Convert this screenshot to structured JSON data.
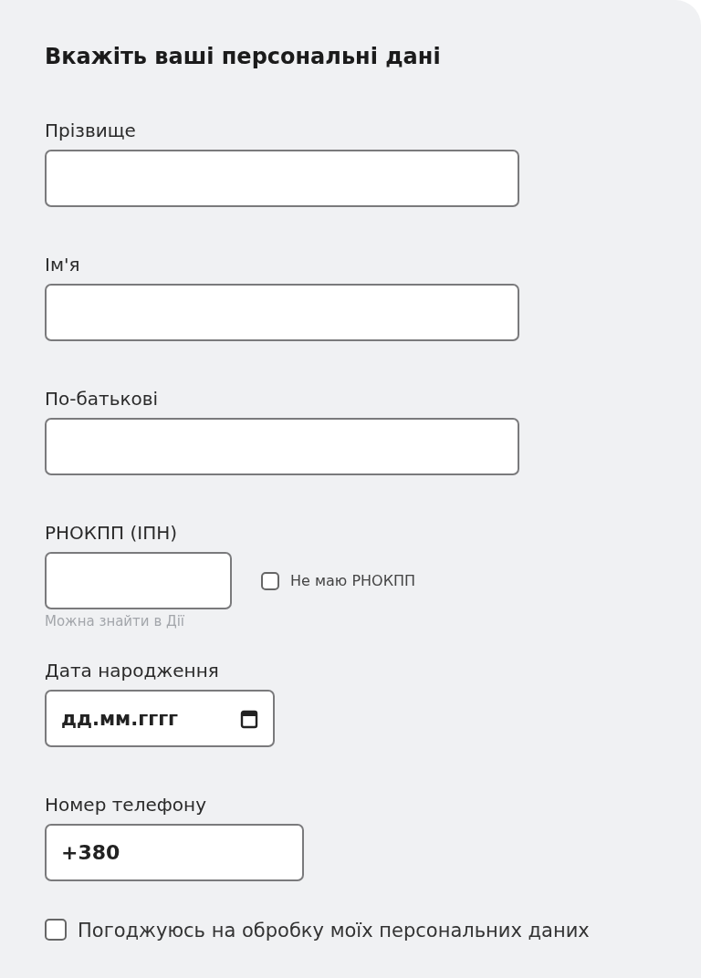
{
  "form": {
    "title": "Вкажіть ваші персональні дані",
    "fields": [
      {
        "kind": "text",
        "label": "Прізвище"
      },
      {
        "kind": "text",
        "label": "Ім'я"
      },
      {
        "kind": "text",
        "label": "По-батькові"
      },
      {
        "kind": "tax",
        "label": "РНОКПП (ІПН)",
        "hint": "Можна знайти в Дії",
        "option": {
          "label": "Не маю РНОКПП",
          "checked": false
        }
      },
      {
        "kind": "date",
        "label": "Дата народження",
        "placeholder": "дд.мм.гггг"
      },
      {
        "kind": "phone",
        "label": "Номер телефону",
        "value": "+380"
      }
    ],
    "consent": {
      "label": "Погоджуюсь на обробку моїх персональних даних",
      "checked": false
    }
  }
}
